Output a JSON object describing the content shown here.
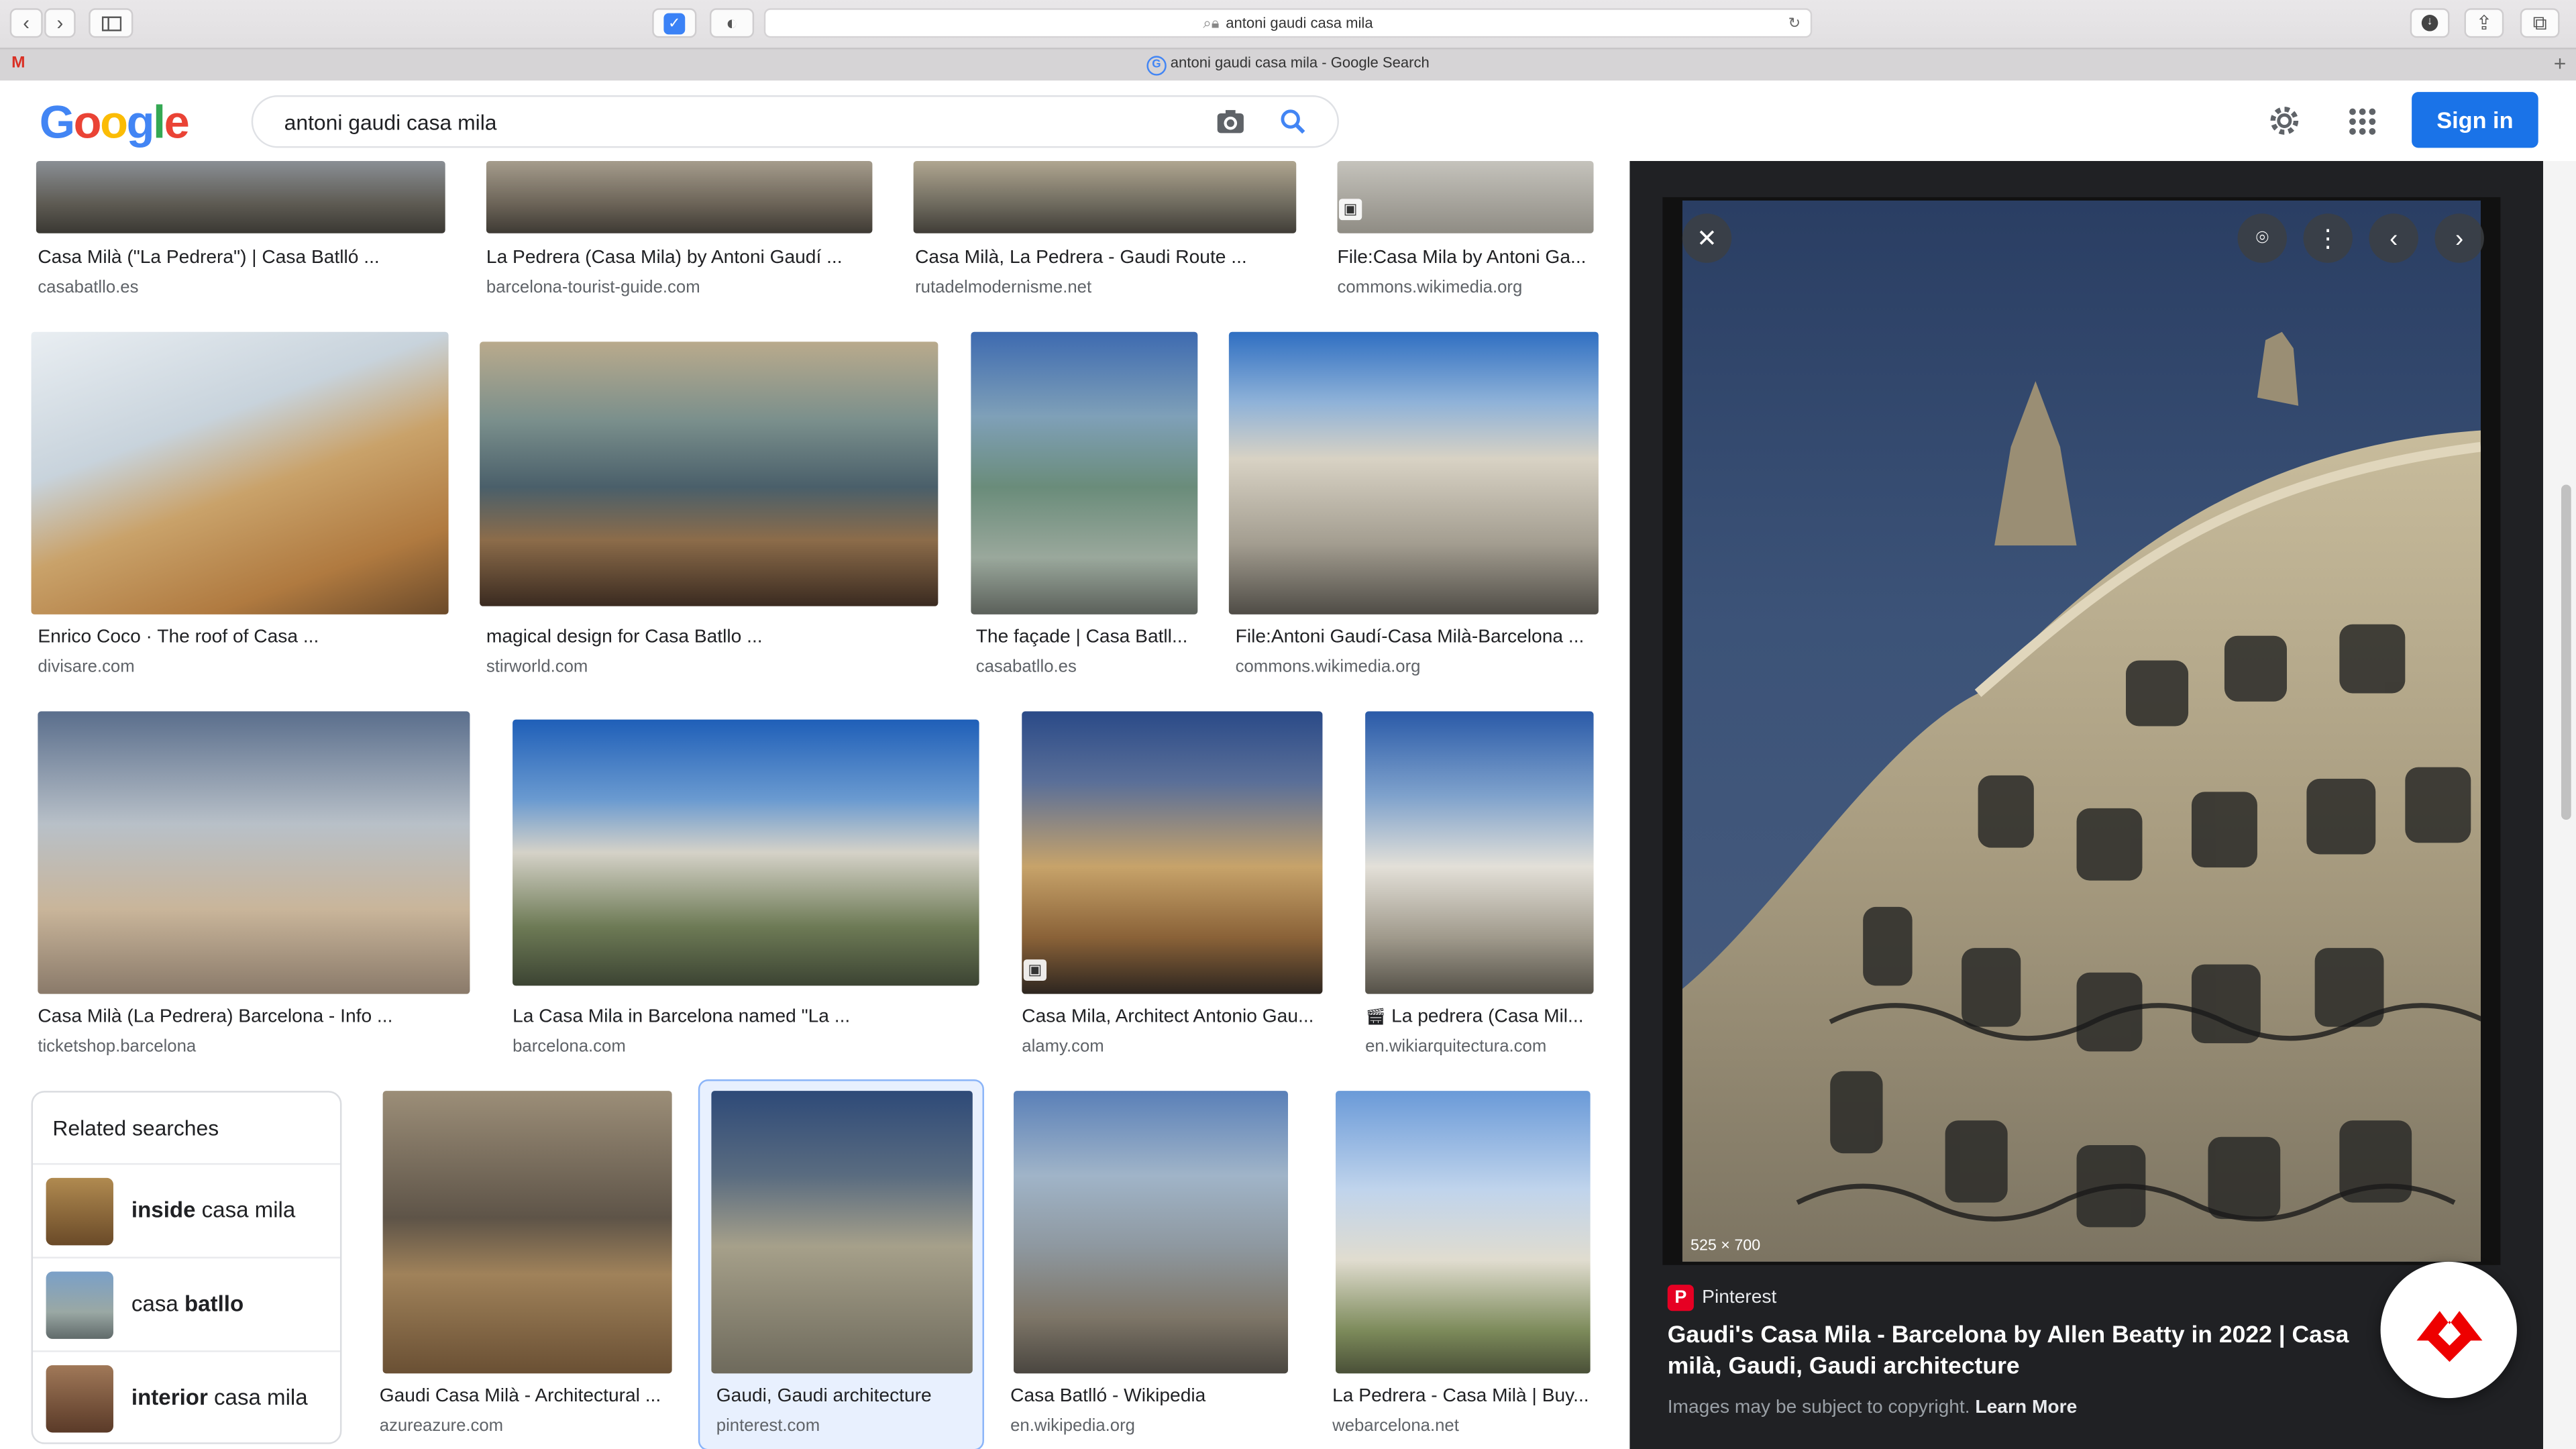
{
  "browser": {
    "address": "antoni gaudi casa mila",
    "tab_title": "antoni gaudi casa mila - Google Search"
  },
  "header": {
    "logo": "Google",
    "query": "antoni gaudi casa mila",
    "signin_label": "Sign in"
  },
  "results": [
    {
      "title": "Casa Milà (\"La Pedrera\") | Casa Batlló ...",
      "source": "casabatllo.es"
    },
    {
      "title": "La Pedrera (Casa Mila) by Antoni Gaudí ...",
      "source": "barcelona-tourist-guide.com"
    },
    {
      "title": "Casa Milà, La Pedrera - Gaudi Route ...",
      "source": "rutadelmodernisme.net"
    },
    {
      "title": "File:Casa Mila by Antoni Ga...",
      "source": "commons.wikimedia.org"
    },
    {
      "title": "Enrico Coco · The roof of Casa ...",
      "source": "divisare.com"
    },
    {
      "title": "magical design for Casa Batllo ...",
      "source": "stirworld.com"
    },
    {
      "title": "The façade | Casa Batll...",
      "source": "casabatllo.es"
    },
    {
      "title": "File:Antoni Gaudí-Casa Milà-Barcelona ...",
      "source": "commons.wikimedia.org"
    },
    {
      "title": "Casa Milà (La Pedrera) Barcelona - Info ...",
      "source": "ticketshop.barcelona"
    },
    {
      "title": "La Casa Mila in Barcelona named \"La ...",
      "source": "barcelona.com"
    },
    {
      "title": "Casa Mila, Architect Antonio Gau...",
      "source": "alamy.com"
    },
    {
      "title": "La pedrera (Casa Mil...",
      "source": "en.wikiarquitectura.com"
    },
    {
      "title": "Gaudi Casa Milà - Architectural ...",
      "source": "azureazure.com"
    },
    {
      "title": "Gaudi, Gaudi architecture",
      "source": "pinterest.com"
    },
    {
      "title": "Casa Batlló - Wikipedia",
      "source": "en.wikipedia.org"
    },
    {
      "title": "La Pedrera - Casa Milà | Buy...",
      "source": "webarcelona.net"
    }
  ],
  "related": {
    "heading": "Related searches",
    "items": [
      {
        "bold": "inside",
        "rest": " casa mila"
      },
      {
        "plain": "casa ",
        "bold2": "batllo"
      },
      {
        "bold": "interior",
        "rest": " casa mila"
      }
    ]
  },
  "panel": {
    "dimensions": "525 × 700",
    "source": "Pinterest",
    "title": "Gaudi's Casa Mila - Barcelona by Allen Beatty in 2022 | Casa milà, Gaudi, Gaudi architecture",
    "note": "Images may be subject to copyright.",
    "learn_more": "Learn More"
  },
  "colors": {
    "accent": "#1a73e8",
    "pinterest": "#e60023"
  }
}
